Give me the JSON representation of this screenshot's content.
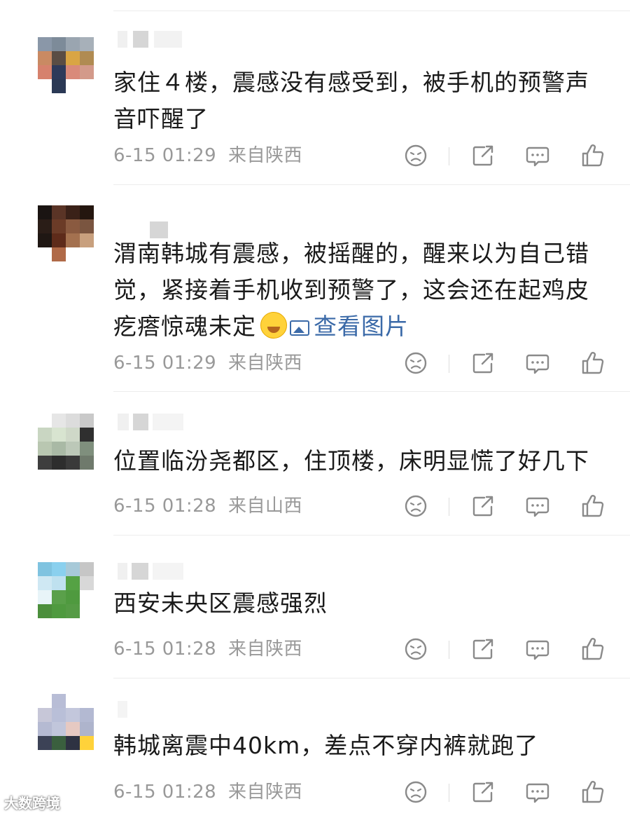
{
  "comments": [
    {
      "text": "家住４楼，震感没有感受到，被手机的预警声音吓醒了",
      "time": "6-15 01:29",
      "location": "来自陕西",
      "avatar": [
        "#8a97a8",
        "#7d8b99",
        "#9aa5b0",
        "#a7b0b9",
        "#c98a63",
        "#5a4d44",
        "#d9a544",
        "#b08b52",
        "#d6816d",
        "#2e3a5a",
        "#d98a7a",
        "#d39a8a",
        "#ffffff",
        "#2b3955",
        "#ffffff",
        "#ffffff"
      ]
    },
    {
      "text": "渭南韩城有震感，被摇醒的，醒来以为自己错觉，紧接着手机收到预警了，这会还在起鸡皮疙瘩惊魂未定",
      "link": "查看图片",
      "time": "6-15 01:29",
      "location": "来自陕西",
      "avatar": [
        "#1a1412",
        "#5a3426",
        "#3a2118",
        "#24160f",
        "#2a1d17",
        "#6b3b27",
        "#8a5a40",
        "#7a5540",
        "#1f1713",
        "#5e2b1a",
        "#a4714f",
        "#c8a07e",
        "#ffffff",
        "#b06a48",
        "#ffffff",
        "#ffffff"
      ]
    },
    {
      "text": "位置临汾尧都区，住顶楼，床明显慌了好几下",
      "time": "6-15 01:28",
      "location": "来自山西",
      "avatar": [
        "#ffffff",
        "#e6e6e6",
        "#dcdcdc",
        "#c9c9c9",
        "#c9d6c2",
        "#d8e4d0",
        "#cfd8c8",
        "#2f2f2f",
        "#b9c7b1",
        "#a9b9a5",
        "#bcc8b8",
        "#7f8f7d",
        "#3e3e3e",
        "#2d2d2d",
        "#3a3a3a",
        "#6f7a6c"
      ]
    },
    {
      "text": "西安未央区震感强烈",
      "time": "6-15 01:28",
      "location": "来自陕西",
      "avatar": [
        "#7fc3e0",
        "#8ad0ee",
        "#a7c9d8",
        "#c6c6c6",
        "#cfe8f3",
        "#bfe1ef",
        "#55a244",
        "#d8d8d8",
        "#e8f4f8",
        "#5aa04a",
        "#4f9a3f",
        "#ffffff",
        "#4c8f3c",
        "#4f9a3f",
        "#559b45",
        "#ffffff"
      ]
    },
    {
      "text": "韩城离震中40km，差点不穿内裤就跑了",
      "time": "6-15 01:28",
      "location": "来自陕西",
      "avatar": [
        "#ffffff",
        "#b8bdd6",
        "#ffffff",
        "#ffffff",
        "#c7c7d8",
        "#b9bfd8",
        "#c3c7dc",
        "#b3b9d2",
        "#b5bad2",
        "#c1c6db",
        "#e6c9c2",
        "#aeb4cc",
        "#3c4256",
        "#3a5f3e",
        "#2e3242",
        "#ffd23a"
      ]
    }
  ],
  "watermark": "大数跨境",
  "colors": {
    "meta": "#999999",
    "link": "#3b6aa8",
    "icon": "#8a8a8a"
  }
}
